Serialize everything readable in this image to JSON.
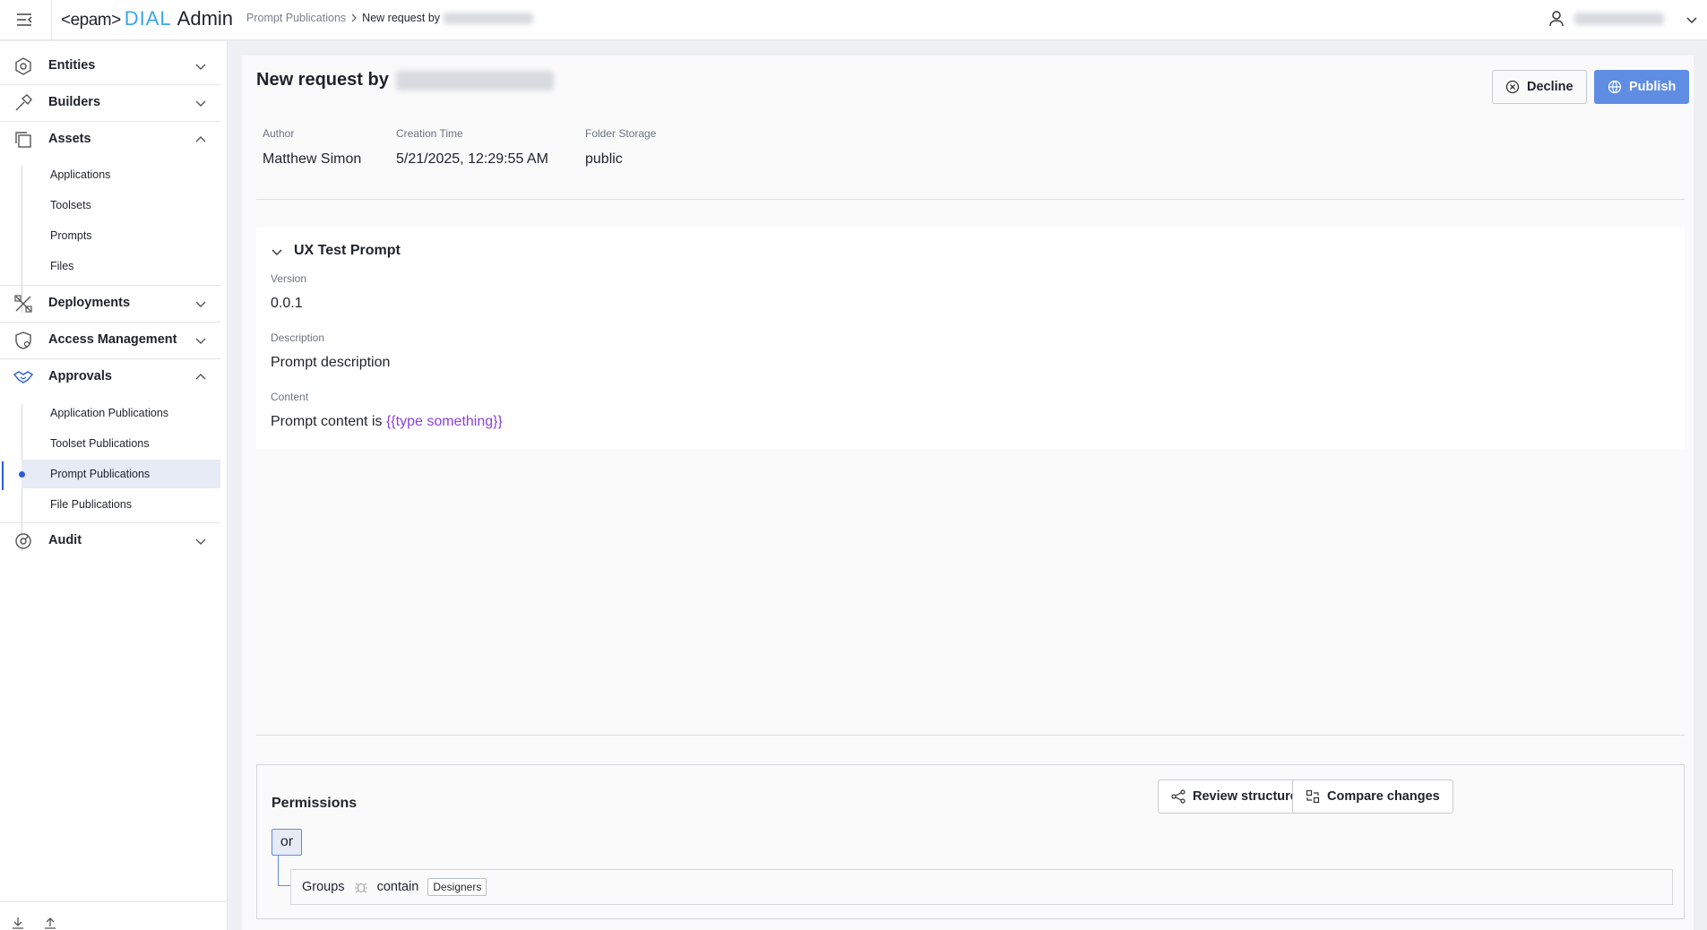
{
  "header": {
    "logo_epam": "<epam>",
    "logo_dial": "DIAL",
    "logo_admin": "Admin",
    "breadcrumb_parent": "Prompt Publications",
    "breadcrumb_current": "New request by"
  },
  "sidebar": {
    "sections": {
      "entities": "Entities",
      "builders": "Builders",
      "assets": "Assets",
      "deployments": "Deployments",
      "access_management": "Access Management",
      "approvals": "Approvals",
      "audit": "Audit"
    },
    "assets_items": [
      "Applications",
      "Toolsets",
      "Prompts",
      "Files"
    ],
    "approvals_items": [
      "Application Publications",
      "Toolset Publications",
      "Prompt Publications",
      "File Publications"
    ],
    "active_item": "Prompt Publications"
  },
  "main": {
    "title": "New request by",
    "decline_label": "Decline",
    "publish_label": "Publish",
    "meta": {
      "author_label": "Author",
      "author_value": "Matthew Simon",
      "creation_label": "Creation Time",
      "creation_value": "5/21/2025, 12:29:55 AM",
      "folder_label": "Folder Storage",
      "folder_value": "public"
    },
    "prompt": {
      "title": "UX Test Prompt",
      "version_label": "Version",
      "version_value": "0.0.1",
      "description_label": "Description",
      "description_value": "Prompt description",
      "content_label": "Content",
      "content_text": "Prompt content is ",
      "content_variable": "{{type something}}"
    },
    "permissions": {
      "title": "Permissions",
      "review_label": "Review structure",
      "compare_label": "Compare changes",
      "operator": "or",
      "rule_field": "Groups",
      "rule_op": "contain",
      "rule_value": "Designers"
    }
  },
  "colors": {
    "accent": "#5f8de4",
    "active_indicator": "#2c5bd6",
    "variable": "#8a3fe0",
    "logo_dial": "#3aa6e6"
  }
}
